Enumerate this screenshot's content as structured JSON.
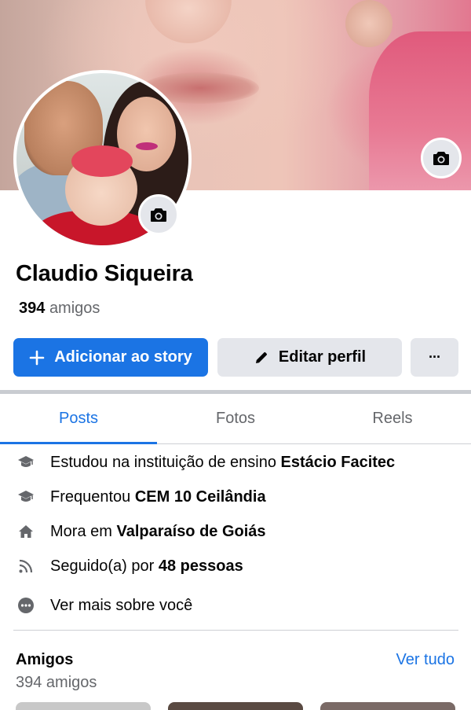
{
  "profile": {
    "name": "Claudio Siqueira",
    "friends_number": "394",
    "friends_label": "amigos"
  },
  "actions": {
    "story_label": "Adicionar ao story",
    "edit_label": "Editar perfil",
    "more_label": "···"
  },
  "tabs": [
    {
      "label": "Posts",
      "active": true
    },
    {
      "label": "Fotos",
      "active": false
    },
    {
      "label": "Reels",
      "active": false
    }
  ],
  "details": [
    {
      "icon": "graduation-cap-icon",
      "prefix": "Estudou na instituição de ensino ",
      "bold": "Estácio Facitec"
    },
    {
      "icon": "graduation-cap-icon",
      "prefix": "Frequentou ",
      "bold": "CEM 10 Ceilândia"
    },
    {
      "icon": "home-icon",
      "prefix": "Mora em ",
      "bold": "Valparaíso de Goiás"
    },
    {
      "icon": "followers-feed-icon",
      "prefix": "Seguido(a) por ",
      "bold": "48 pessoas"
    },
    {
      "icon": "more-dots-icon",
      "prefix": "Ver mais sobre você",
      "bold": ""
    }
  ],
  "friends_section": {
    "title": "Amigos",
    "see_all": "Ver tudo",
    "count_text": "394 amigos"
  },
  "colors": {
    "accent": "#1b74e4",
    "button_gray": "#e4e6eb",
    "secondary_text": "#65676b"
  }
}
